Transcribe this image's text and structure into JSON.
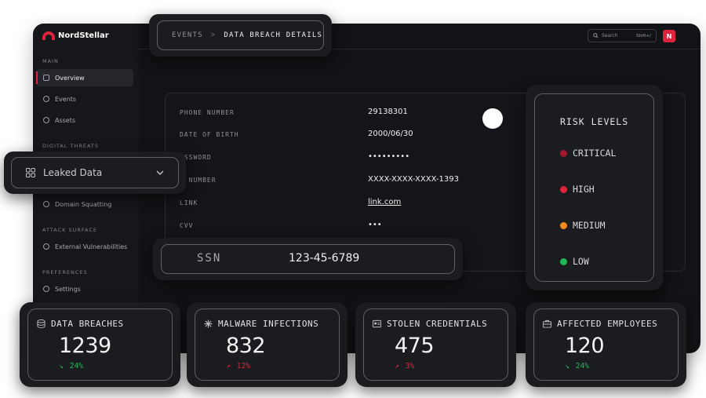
{
  "app": {
    "logo_text": "NordStellar"
  },
  "header": {
    "search_placeholder": "Search",
    "search_shortcut": "Shift+/",
    "avatar_initial": "N"
  },
  "sidebar": {
    "sections": {
      "main": "MAIN",
      "digital_threats": "DIGITAL THREATS",
      "attack_surface": "ATTACK SURFACE",
      "preferences": "PREFERENCES"
    },
    "items": {
      "overview": "Overview",
      "events": "Events",
      "assets": "Assets",
      "domain_squatting": "Domain Squatting",
      "external_vulnerabilities": "External Vulnerabilities",
      "settings": "Settings"
    }
  },
  "breadcrumb": {
    "parent": "EVENTS",
    "separator": ">",
    "current": "DATA BREACH DETAILS"
  },
  "leaked_dropdown": {
    "label": "Leaked Data"
  },
  "details": [
    {
      "label": "PHONE NUMBER",
      "value": "29138301"
    },
    {
      "label": "DATE OF BIRTH",
      "value": "2000/06/30"
    },
    {
      "label": "ASSWORD",
      "value": "•••••••••"
    },
    {
      "label": "C NUMBER",
      "value": "XXXX-XXXX-XXXX-1393"
    },
    {
      "label": "LINK",
      "value": "link.com"
    },
    {
      "label": "CVV",
      "value": "•••"
    }
  ],
  "ssn": {
    "label": "SSN",
    "value": "123-45-6789"
  },
  "risk_levels": {
    "title": "RISK LEVELS",
    "items": [
      {
        "label": "CRITICAL",
        "color": "#a3172e"
      },
      {
        "label": "HIGH",
        "color": "#e0233c"
      },
      {
        "label": "MEDIUM",
        "color": "#f08a1c"
      },
      {
        "label": "LOW",
        "color": "#1fb856"
      }
    ]
  },
  "stats": [
    {
      "title": "DATA BREACHES",
      "icon": "database-icon",
      "value": "1239",
      "arrow": "↘",
      "delta": "24%",
      "trend_color": "#1fb856"
    },
    {
      "title": "MALWARE INFECTIONS",
      "icon": "virus-icon",
      "value": "832",
      "arrow": "↗",
      "delta": "12%",
      "trend_color": "#e0233c"
    },
    {
      "title": "STOLEN CREDENTIALS",
      "icon": "credential-icon",
      "value": "475",
      "arrow": "↗",
      "delta": "3%",
      "trend_color": "#e0233c"
    },
    {
      "title": "AFFECTED EMPLOYEES",
      "icon": "briefcase-icon",
      "value": "120",
      "arrow": "↘",
      "delta": "24%",
      "trend_color": "#1fb856"
    }
  ]
}
